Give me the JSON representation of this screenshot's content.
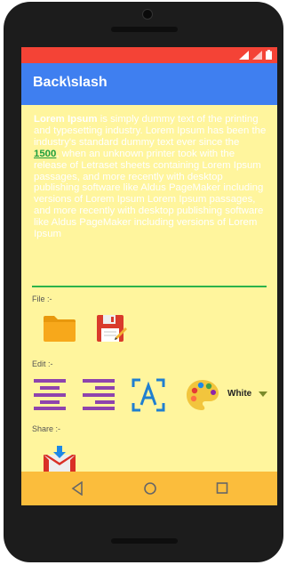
{
  "app": {
    "title": "Back\\slash"
  },
  "text": {
    "lorem_bold": "Lorem Ipsum",
    "lorem_part1": " is simply dummy text of the printing and typesetting industry. Lorem Ipsum has been the industry's standard dummy text ever since the ",
    "lorem_link": "1500",
    "lorem_part2": ", when an unknown printer took with the release of Letraset sheets containing Lorem Ipsum passages, and more recently with desktop publishing software like Aldus PageMaker including versions of Lorem Ipsum Lorem Ipsum passages, and more recently with desktop publishing software like Aldus PageMaker including versions of Lorem Ipsum"
  },
  "sections": {
    "file_label": "File :-",
    "edit_label": "Edit :-",
    "share_label": "Share :-"
  },
  "color_select": {
    "value": "White"
  },
  "colors": {
    "statusbar": "#f44336",
    "appbar": "#3f7ff0",
    "background": "#fff59d",
    "navbar": "#fbbd3c",
    "accent_underline": "#2cb34a"
  },
  "icons": {
    "file": [
      "folder-icon",
      "save-icon"
    ],
    "edit": [
      "align-left-icon",
      "align-right-icon",
      "font-icon",
      "palette-icon"
    ],
    "share": [
      "gmail-icon"
    ],
    "nav": [
      "back-icon",
      "home-icon",
      "recents-icon"
    ]
  }
}
